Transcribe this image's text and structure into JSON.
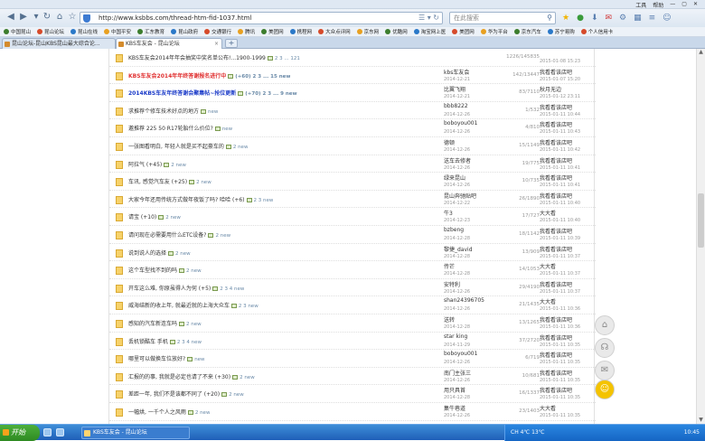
{
  "window": {
    "menu": [
      "工具",
      "帮助"
    ]
  },
  "toolbar": {
    "url": "http://www.ksbbs.com/thread-htm-fid-1037.html",
    "search_placeholder": "在此搜索"
  },
  "bookmarks": [
    "中国昆山",
    "昆山论坛",
    "昆山在线",
    "中国平安",
    "汇东教育",
    "昆山政府",
    "交通银行",
    "腾讯",
    "美团网",
    "携程网",
    "大众点评网",
    "京东网",
    "优酷网",
    "淘宝网上医",
    "美团网",
    "华为平台",
    "京东汽车",
    "苏宁易购",
    "个人信用卡"
  ],
  "tabs": [
    {
      "label": "昆山论坛-昆山KBS昆山最大综合论...",
      "active": false
    },
    {
      "label": "KBS车友会 - 昆山论坛",
      "active": true
    }
  ],
  "threads": [
    {
      "title": "KBS车友会2014年年会抽奖中奖名单公布!...1900-1999",
      "style": "normal",
      "extra": "2 3 ... 121",
      "author": "",
      "adate": "",
      "stats": "1226/145835",
      "last": "",
      "ldate": "2015-01-08 15:23"
    },
    {
      "title": "KBS车友会2014年年终答谢报名进行中",
      "style": "hl",
      "extra": "(+60)  2 3 ... 15 new",
      "author": "kbs车友会",
      "adate": "2014-12-21",
      "stats": "142/13447",
      "last": "我看看该店吧",
      "ldate": "2015-01-07 15:20"
    },
    {
      "title": "2014KBS车友年终答谢会聚集帖~抢位更新",
      "style": "blue",
      "extra": "(+70)  2 3 ... 9 new",
      "author": "比翼飞翔",
      "adate": "2014-12-21",
      "stats": "83/7110",
      "last": "秋月无边",
      "ldate": "2015-01-12 23:11"
    },
    {
      "title": "求推荐个修车技术好点的地方",
      "style": "normal",
      "extra": "new",
      "author": "bbb8222",
      "adate": "2014-12-26",
      "stats": "1/532",
      "last": "我看看该店吧",
      "ldate": "2015-01-11 10:44"
    },
    {
      "title": "邀推荐 225 50 R17轮胎什么价位?",
      "style": "normal",
      "extra": "new",
      "author": "boboyou001",
      "adate": "2014-12-26",
      "stats": "4/810",
      "last": "我看看该店吧",
      "ldate": "2015-01-11 10:43"
    },
    {
      "title": "一张图看明白, 年轻人就是买不起豪车的",
      "style": "normal",
      "extra": "2 new",
      "author": "德顿",
      "adate": "2014-12-26",
      "stats": "15/1149",
      "last": "我看看该店吧",
      "ldate": "2015-01-11 10:42"
    },
    {
      "title": "阿拉气 (+45)",
      "style": "normal",
      "extra": "2 new",
      "author": "送车去修者",
      "adate": "2014-12-26",
      "stats": "19/775",
      "last": "我看看该店吧",
      "ldate": "2015-01-11 10:41"
    },
    {
      "title": "车讯, 感觉汽车友 (+25)",
      "style": "normal",
      "extra": "2 new",
      "author": "绿来昆山",
      "adate": "2014-12-26",
      "stats": "10/735",
      "last": "我看看该店吧",
      "ldate": "2015-01-11 10:41"
    },
    {
      "title": "大家今年还用传统方式做年夜饭了吗? 哈哈 (+6)",
      "style": "normal",
      "extra": "2 3 new",
      "author": "昆山奔驰贴吧",
      "adate": "2014-12-22",
      "stats": "26/1890",
      "last": "我看看该店吧",
      "ldate": "2015-01-11 10:40"
    },
    {
      "title": "请宝 (+10)",
      "style": "normal",
      "extra": "2 new",
      "author": "牛3",
      "adate": "2014-12-23",
      "stats": "17/727",
      "last": "大大看",
      "ldate": "2015-01-11 10:40"
    },
    {
      "title": "请问现在必需要用什么ETC设备?",
      "style": "normal",
      "extra": "2 new",
      "author": "bzbeng",
      "adate": "2014-12-28",
      "stats": "18/1142",
      "last": "我看看该店吧",
      "ldate": "2015-01-11 10:39"
    },
    {
      "title": "说到说人的选择",
      "style": "normal",
      "extra": "2 new",
      "author": "黎捷_david",
      "adate": "2014-12-28",
      "stats": "13/909",
      "last": "我看看该店吧",
      "ldate": "2015-01-11 10:37"
    },
    {
      "title": "这个车型找不到的吗",
      "style": "normal",
      "extra": "2 new",
      "author": "传芒",
      "adate": "2014-12-28",
      "stats": "14/1053",
      "last": "大大看",
      "ldate": "2015-01-11 10:37"
    },
    {
      "title": "开车这么难, 你原虽得人为何 (+5)",
      "style": "normal",
      "extra": "2 3 4 new",
      "author": "安特利",
      "adate": "2014-12-26",
      "stats": "29/4190",
      "last": "我看看该店吧",
      "ldate": "2015-01-11 10:37"
    },
    {
      "title": "威海结新的收上年, 就最近就的上海大众车",
      "style": "normal",
      "extra": "2 3 new",
      "author": "shan24396705",
      "adate": "2014-12-26",
      "stats": "21/1435",
      "last": "大大看",
      "ldate": "2015-01-11 10:36"
    },
    {
      "title": "感知的汽车新连车吗",
      "style": "normal",
      "extra": "2 new",
      "author": "送转",
      "adate": "2014-12-28",
      "stats": "13/1265",
      "last": "我看看该店吧",
      "ldate": "2015-01-11 10:36"
    },
    {
      "title": "丢机锁酷车 手机",
      "style": "normal",
      "extra": "2 3 4 new",
      "author": "star king",
      "adate": "2014-11-29",
      "stats": "37/2720",
      "last": "我看看该店吧",
      "ldate": "2015-01-11 10:35"
    },
    {
      "title": "哪里可以做换车位放好?",
      "style": "normal",
      "extra": "new",
      "author": "boboyou001",
      "adate": "2014-12-26",
      "stats": "6/719",
      "last": "我看看该店吧",
      "ldate": "2015-01-11 10:35"
    },
    {
      "title": "汇报的的事, 我就是必定也请了不来 (+30)",
      "style": "normal",
      "extra": "2 new",
      "author": "南门主张三",
      "adate": "2014-12-26",
      "stats": "10/681",
      "last": "我看看该店吧",
      "ldate": "2015-01-11 10:35"
    },
    {
      "title": "差距一年, 我们不是该都不同了 (+20)",
      "style": "normal",
      "extra": "2 new",
      "author": "用只具首",
      "adate": "2014-12-28",
      "stats": "16/1337",
      "last": "我看看该店吧",
      "ldate": "2015-01-11 10:35"
    },
    {
      "title": "一幅烘, 一千个人之风雨",
      "style": "normal",
      "extra": "2 new",
      "author": "集牛巷道",
      "adate": "2014-12-26",
      "stats": "23/1403",
      "last": "大大看",
      "ldate": "2015-01-11 10:35"
    }
  ],
  "float_buttons": [
    "top-arrow",
    "headset",
    "wechat",
    "smile"
  ],
  "taskbar": {
    "start_label": "开始",
    "task_label": "KBS车友会 - 昆山论坛",
    "tray_text": "CH  4℃  13℃",
    "clock": "10:45"
  }
}
